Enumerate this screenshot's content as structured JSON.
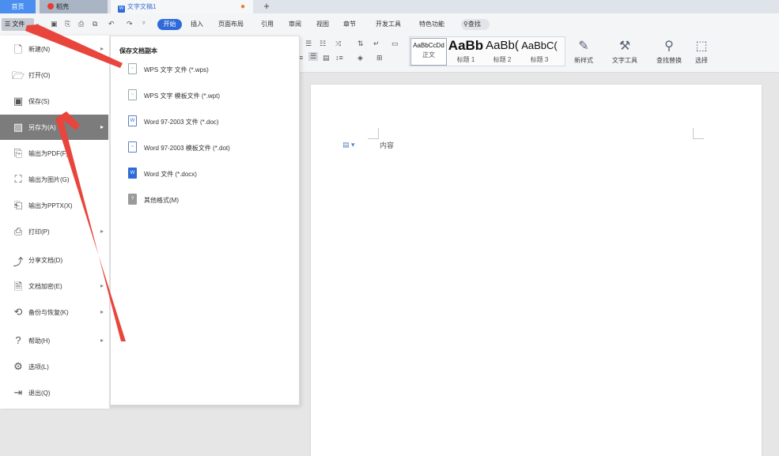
{
  "tabs": {
    "home": "首页",
    "daoke": "稻壳",
    "doc": "文字文稿1",
    "new_tab": "+"
  },
  "menubar": {
    "file": "文件",
    "start": "开始",
    "items": [
      "插入",
      "页面布局",
      "引用",
      "审阅",
      "视图",
      "章节",
      "开发工具",
      "特色功能"
    ],
    "search": "查找"
  },
  "ribbon": {
    "styles": [
      {
        "sample": "AaBbCcDd",
        "name": "正文"
      },
      {
        "sample": "AaBb",
        "name": "标题 1"
      },
      {
        "sample": "AaBb(",
        "name": "标题 2"
      },
      {
        "sample": "AaBbC(",
        "name": "标题 3"
      }
    ],
    "tools": [
      {
        "icon": "new-style-icon",
        "label": "新样式"
      },
      {
        "icon": "text-tools-icon",
        "label": "文字工具"
      },
      {
        "icon": "find-replace-icon",
        "label": "查找替换"
      },
      {
        "icon": "select-icon",
        "label": "选择"
      }
    ]
  },
  "file_menu": {
    "items": [
      {
        "label": "新建(N)",
        "icon": "new-doc-icon",
        "has_submenu": true
      },
      {
        "label": "打开(O)",
        "icon": "folder-icon",
        "has_submenu": false
      },
      {
        "label": "保存(S)",
        "icon": "save-icon",
        "has_submenu": false
      },
      {
        "label": "另存为(A)",
        "icon": "save-as-icon",
        "has_submenu": true,
        "active": true
      },
      {
        "label": "输出为PDF(F)",
        "icon": "pdf-icon",
        "has_submenu": false
      },
      {
        "label": "输出为图片(G)",
        "icon": "image-icon",
        "has_submenu": false
      },
      {
        "label": "输出为PPTX(X)",
        "icon": "pptx-icon",
        "has_submenu": false
      },
      {
        "label": "打印(P)",
        "icon": "print-icon",
        "has_submenu": true
      },
      {
        "label": "分享文档(D)",
        "icon": "share-icon",
        "has_submenu": false
      },
      {
        "label": "文档加密(E)",
        "icon": "encrypt-icon",
        "has_submenu": true
      },
      {
        "label": "备份与恢复(K)",
        "icon": "backup-icon",
        "has_submenu": true
      },
      {
        "label": "帮助(H)",
        "icon": "help-icon",
        "has_submenu": true
      },
      {
        "label": "选项(L)",
        "icon": "gear-icon",
        "has_submenu": false
      },
      {
        "label": "退出(Q)",
        "icon": "exit-icon",
        "has_submenu": false
      }
    ]
  },
  "save_as_menu": {
    "title": "保存文档副本",
    "items": [
      {
        "label": "WPS 文字 文件 (*.wps)",
        "icon": "wps-file-icon"
      },
      {
        "label": "WPS 文字 模板文件 (*.wpt)",
        "icon": "wpt-file-icon"
      },
      {
        "label": "Word 97-2003 文件 (*.doc)",
        "icon": "doc-file-icon"
      },
      {
        "label": "Word 97-2003 模板文件 (*.dot)",
        "icon": "dot-file-icon"
      },
      {
        "label": "Word 文件 (*.docx)",
        "icon": "docx-file-icon"
      },
      {
        "label": "其他格式(M)",
        "icon": "other-format-icon"
      }
    ]
  },
  "document": {
    "content": "内容"
  },
  "colors": {
    "accent": "#2f6bd8",
    "active_menu": "#7c7c7c",
    "annotation_arrow": "#e8453c"
  }
}
